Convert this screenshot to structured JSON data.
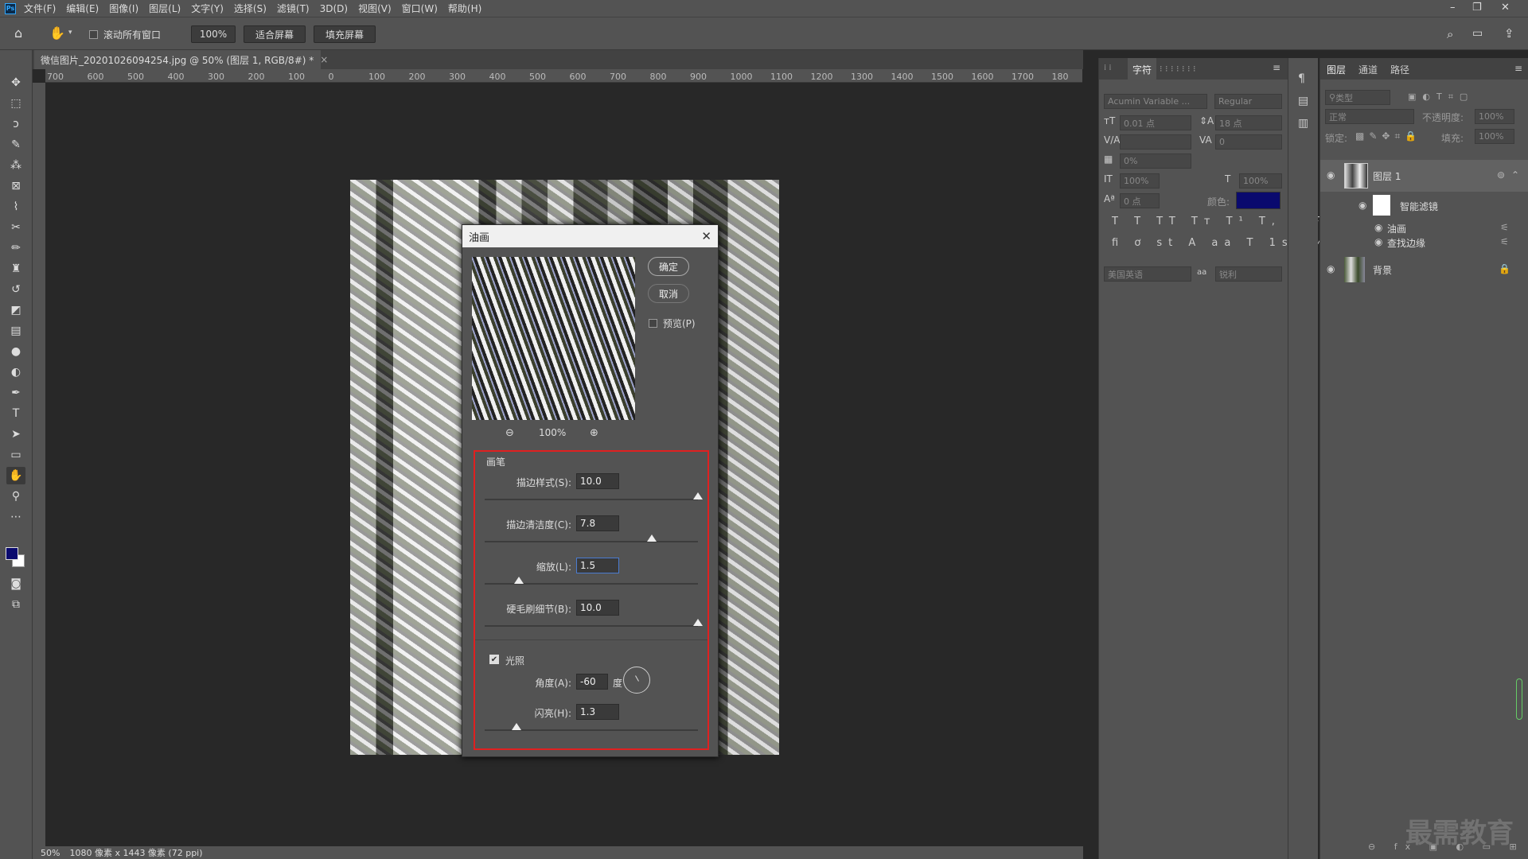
{
  "menubar": {
    "logo": "Ps",
    "items": [
      "文件(F)",
      "编辑(E)",
      "图像(I)",
      "图层(L)",
      "文字(Y)",
      "选择(S)",
      "滤镜(T)",
      "3D(D)",
      "视图(V)",
      "窗口(W)",
      "帮助(H)"
    ]
  },
  "options": {
    "scroll_all_label": "滚动所有窗口",
    "zoom_value": "100%",
    "fit_screen": "适合屏幕",
    "fill_screen": "填充屏幕"
  },
  "document": {
    "tab_title": "微信图片_20201026094254.jpg @ 50% (图层 1, RGB/8#) *",
    "ruler_labels": [
      "700",
      "600",
      "500",
      "400",
      "300",
      "200",
      "100",
      "0",
      "100",
      "200",
      "300",
      "400",
      "500",
      "600",
      "700",
      "800",
      "900",
      "1000",
      "1100",
      "1200",
      "1300",
      "1400",
      "1500",
      "1600",
      "1700",
      "180"
    ]
  },
  "status": {
    "zoom": "50%",
    "info": "1080 像素 x 1443 像素 (72 ppi)"
  },
  "character": {
    "tab": "字符",
    "font_family": "Acumin Variable ...",
    "font_style": "Regular",
    "size": "0.01 点",
    "leading": "18 点",
    "tracking": "0",
    "scale_pct": "0%",
    "vscale": "100%",
    "hscale": "100%",
    "baseline": "0 点",
    "color_label": "颜色:",
    "color": "#0a0a6e",
    "language": "美国英语",
    "aa_label": "aa",
    "antialias": "锐利"
  },
  "layers": {
    "tabs": [
      "图层",
      "通道",
      "路径"
    ],
    "filter_kind": "类型",
    "blend_mode": "正常",
    "opacity_label": "不透明度:",
    "opacity": "100%",
    "lock_label": "锁定:",
    "fill_label": "填充:",
    "fill": "100%",
    "items": [
      {
        "name": "图层 1"
      },
      {
        "name": "智能滤镜"
      },
      {
        "name": "油画"
      },
      {
        "name": "查找边缘"
      },
      {
        "name": "背景"
      }
    ]
  },
  "dialog": {
    "title": "油画",
    "ok": "确定",
    "cancel": "取消",
    "preview_label": "预览(P)",
    "zoom": "100%",
    "brush_section": "画笔",
    "params": [
      {
        "label": "描边样式(S):",
        "value": "10.0",
        "position": 1.0
      },
      {
        "label": "描边清洁度(C):",
        "value": "7.8",
        "position": 0.78
      },
      {
        "label": "缩放(L):",
        "value": "1.5",
        "position": 0.14
      },
      {
        "label": "硬毛刷细节(B):",
        "value": "10.0",
        "position": 1.0
      }
    ],
    "lighting_label": "光照",
    "angle_label": "角度(A):",
    "angle": "-60",
    "degree": "度",
    "shine_label": "闪亮(H):",
    "shine": "1.3",
    "shine_position": 0.13
  },
  "watermark": "最需教育"
}
